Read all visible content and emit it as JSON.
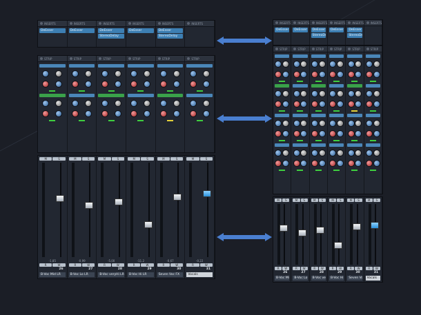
{
  "headers": {
    "inserts": "INSERTS",
    "strip": "STRIP"
  },
  "left": {
    "insert_slots": [
      [
        "DeEsser"
      ],
      [
        "DeEsser"
      ],
      [
        "DeEsser",
        "StereoDelay"
      ],
      [
        "DeEsser"
      ],
      [
        "DeEsser",
        "StereoDelay"
      ],
      []
    ],
    "channel_numbers": [
      "26",
      "27",
      "28",
      "29",
      "30",
      "31"
    ],
    "channel_names": [
      "B-Voc Mid LR",
      "B-Voc Lo LR",
      "B-Voc veryHi LR",
      "B-Voc Hi LR",
      "Seven Voc FX",
      "Vocals"
    ],
    "level_values": [
      "-1.85",
      "-0.99",
      "-5.00",
      "-11.2",
      "-0.67",
      "-0.22"
    ],
    "selected_channel": 5
  },
  "right": {
    "insert_slots": [
      [
        "DeEsser"
      ],
      [
        "DeEsser"
      ],
      [
        "DeEsser",
        "StereoDelay"
      ],
      [
        "DeEsser"
      ],
      [
        "DeEsser",
        "StereoDelay"
      ],
      []
    ],
    "channel_numbers": [
      "26",
      "27",
      "28",
      "29",
      "30",
      "31"
    ],
    "channel_names": [
      "B-Voc Mid LR",
      "B-Voc Lo LR",
      "B-Voc veryHi LR",
      "B-Voc Hi LR",
      "Seven Voc FX",
      "Vocals"
    ]
  },
  "colors": {
    "arrow": "#4a7fd0",
    "selected_fader": "#2a8fd9"
  }
}
